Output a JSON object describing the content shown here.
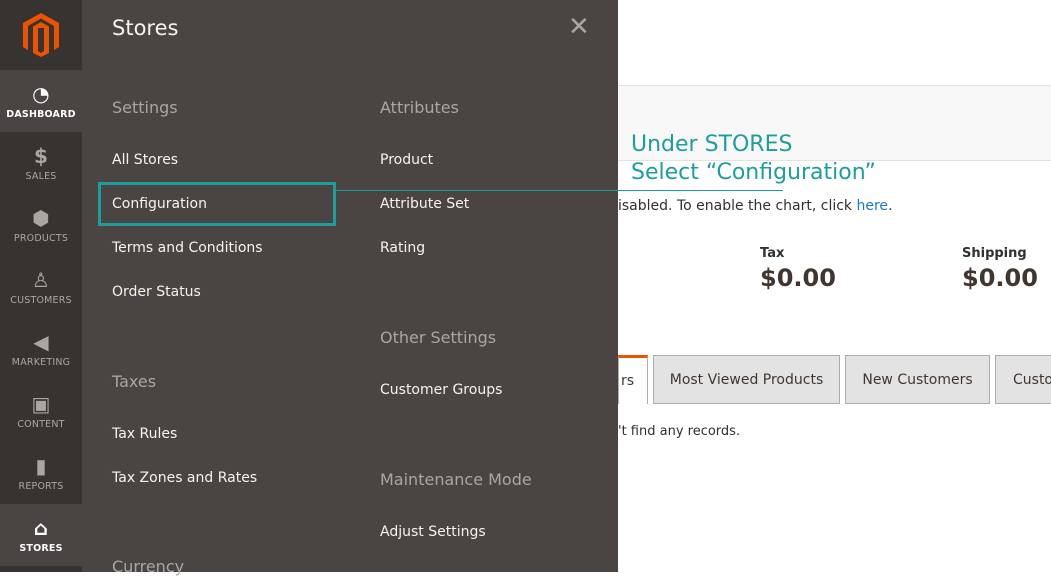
{
  "sidebar": {
    "items": [
      {
        "label": "DASHBOARD",
        "icon": "dashboard-icon"
      },
      {
        "label": "SALES",
        "icon": "dollar-icon"
      },
      {
        "label": "PRODUCTS",
        "icon": "box-icon"
      },
      {
        "label": "CUSTOMERS",
        "icon": "person-icon"
      },
      {
        "label": "MARKETING",
        "icon": "megaphone-icon"
      },
      {
        "label": "CONTENT",
        "icon": "layout-icon"
      },
      {
        "label": "REPORTS",
        "icon": "bar-chart-icon"
      },
      {
        "label": "STORES",
        "icon": "storefront-icon"
      }
    ]
  },
  "panel": {
    "title": "Stores",
    "settings": {
      "heading": "Settings",
      "items": [
        "All Stores",
        "Configuration",
        "Terms and Conditions",
        "Order Status"
      ]
    },
    "taxes": {
      "heading": "Taxes",
      "items": [
        "Tax Rules",
        "Tax Zones and Rates"
      ]
    },
    "currency": {
      "heading": "Currency"
    },
    "attributes": {
      "heading": "Attributes",
      "items": [
        "Product",
        "Attribute Set",
        "Rating"
      ]
    },
    "other": {
      "heading": "Other Settings",
      "items": [
        "Customer Groups"
      ]
    },
    "maintenance": {
      "heading": "Maintenance Mode",
      "items": [
        "Adjust Settings"
      ]
    }
  },
  "annotation": {
    "line1": "Under STORES",
    "line2": "Select “Configuration”"
  },
  "main": {
    "chart_msg": "isabled. To enable the chart, click ",
    "chart_link": "here",
    "chart_end": ".",
    "tax_label": "Tax",
    "tax_value": "$0.00",
    "shipping_label": "Shipping",
    "shipping_value": "$0.00",
    "tabs": [
      "rs",
      "Most Viewed Products",
      "New Customers",
      "Custo"
    ],
    "no_records": "'t find any records."
  },
  "colors": {
    "accent": "#1e9e9a",
    "brand": "#eb5202",
    "panel": "#4a4542",
    "sidebar": "#373330"
  }
}
